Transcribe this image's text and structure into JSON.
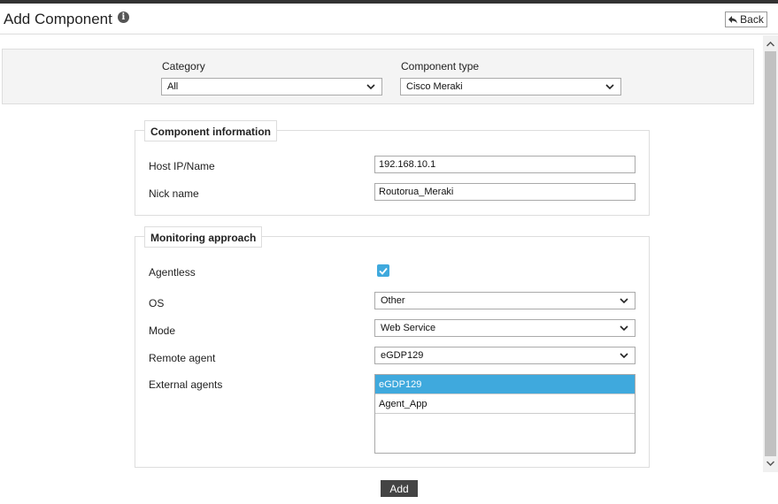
{
  "header": {
    "title": "Add Component",
    "info_icon": "info-icon",
    "back_label": "Back"
  },
  "filters": {
    "category": {
      "label": "Category",
      "value": "All"
    },
    "component_type": {
      "label": "Component type",
      "value": "Cisco Meraki"
    }
  },
  "component_info": {
    "legend": "Component information",
    "host": {
      "label": "Host IP/Name",
      "value": "192.168.10.1"
    },
    "nick": {
      "label": "Nick name",
      "value": "Routorua_Meraki"
    }
  },
  "monitoring": {
    "legend": "Monitoring approach",
    "agentless": {
      "label": "Agentless",
      "checked": true
    },
    "os": {
      "label": "OS",
      "value": "Other"
    },
    "mode": {
      "label": "Mode",
      "value": "Web Service"
    },
    "remote_agent": {
      "label": "Remote agent",
      "value": "eGDP129"
    },
    "external_agents": {
      "label": "External agents",
      "options": [
        "eGDP129",
        "Agent_App"
      ],
      "selected": "eGDP129"
    }
  },
  "actions": {
    "add_label": "Add"
  },
  "colors": {
    "accent": "#3fa9dd",
    "button_dark": "#444444"
  }
}
